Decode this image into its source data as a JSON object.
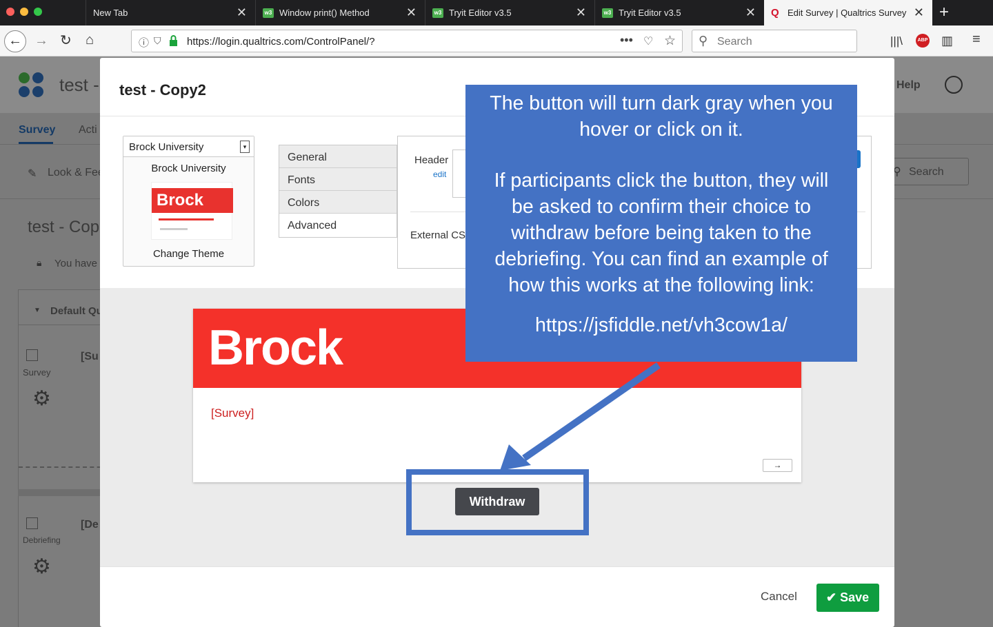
{
  "browser": {
    "tabs": [
      {
        "label": "New Tab"
      },
      {
        "label": "Window print() Method"
      },
      {
        "label": "Tryit Editor v3.5"
      },
      {
        "label": "Tryit Editor v3.5"
      },
      {
        "label": "Edit Survey | Qualtrics Survey"
      }
    ],
    "url": "https://login.qualtrics.com/ControlPanel/?",
    "search_placeholder": "Search"
  },
  "app": {
    "title": "test -",
    "nav_survey": "Survey",
    "nav_actions": "Acti",
    "look_feel": "Look & Fee",
    "survey_title": "test - Cop",
    "you_have": "You have",
    "default_q": "Default Qu",
    "block1_label": "[Su",
    "block1_type": "Survey",
    "block2_label": "[De",
    "block2_type": "Debriefing",
    "help": "Help",
    "search": "Search"
  },
  "modal": {
    "title": "test - Copy2",
    "theme_select": "Brock University",
    "theme_name": "Brock University",
    "thumb_logo": "Brock",
    "change_theme": "Change Theme",
    "side_tabs": [
      "General",
      "Fonts",
      "Colors",
      "Advanced"
    ],
    "header_label": "Header",
    "edit_link": "edit",
    "external_css": "External CS",
    "brock_logo": "Brock",
    "survey_text": "[Survey]",
    "next_arrow": "→",
    "withdraw": "Withdraw",
    "cancel": "Cancel",
    "save": "Save"
  },
  "annotation": {
    "line1": "The button will turn dark gray when you",
    "line2": "hover or click on it.",
    "line3": "If participants click the button, they will",
    "line4": "be asked to confirm their choice to",
    "line5": "withdraw before being taken to the",
    "line6": "debriefing. You can find an example of",
    "line7": "how this works at the following link:",
    "link": "https://jsfiddle.net/vh3cow1a/"
  },
  "colors": {
    "brock_red": "#f4312a",
    "annotation_blue": "#4472c4",
    "save_green": "#0f9d3f",
    "withdraw_gray": "#45474c"
  }
}
